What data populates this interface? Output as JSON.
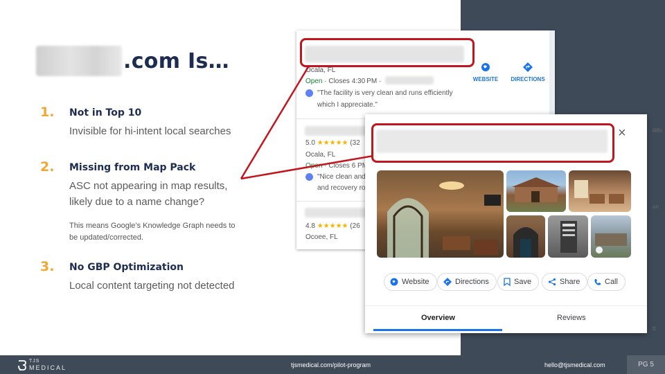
{
  "slide": {
    "title": ".com Is…",
    "items": [
      {
        "num": "1.",
        "heading": "Not in Top 10",
        "body": "Invisible for hi-intent local searches"
      },
      {
        "num": "2.",
        "heading": "Missing from Map Pack",
        "body1": "ASC not appearing in map results,",
        "body2": "likely due to a name change?",
        "note1": "This means Google’s Knowledge Graph needs to",
        "note2": "be updated/corrected."
      },
      {
        "num": "3.",
        "heading": "No GBP Optimization",
        "body": "Local content targeting not detected"
      }
    ]
  },
  "listing": {
    "r1_location": "Ocala, FL",
    "r1_open": "Open",
    "r1_hours": " · Closes 4:30 PM ·",
    "r1_quote1": "\"The facility is very clean and runs efficiently",
    "r1_quote2": "which I appreciate.\"",
    "website_label": "WEBSITE",
    "directions_label": "DIRECTIONS",
    "r2_rating": "5.0",
    "r2_count": "(32",
    "r2_location": "Ocala, FL",
    "r2_open": "Open",
    "r2_hours": " · Closes 6 PM",
    "r2_quote1": "\"Nice clean and",
    "r2_quote2": "and recovery ro",
    "r3_rating": "4.8",
    "r3_count": "(26",
    "r3_location": "Ocoee, FL",
    "stars": "★★★★★"
  },
  "place_card": {
    "close": "×",
    "actions": [
      "Website",
      "Directions",
      "Save",
      "Share",
      "Call"
    ],
    "tabs": [
      "Overview",
      "Reviews"
    ]
  },
  "map_labels": [
    "illifo",
    "on",
    "tt"
  ],
  "footer": {
    "logo_top": "TJS",
    "logo_bottom": "MEDICAL",
    "url": "tjsmedical.com/pilot-program",
    "email": "hello@tjsmedical.com",
    "page": "PG 5"
  },
  "colors": {
    "navy": "#1d2d52",
    "accent_orange": "#f4a632",
    "highlight_red": "#c2161f",
    "panel": "#3f4a59",
    "google_blue": "#1a73e8"
  }
}
